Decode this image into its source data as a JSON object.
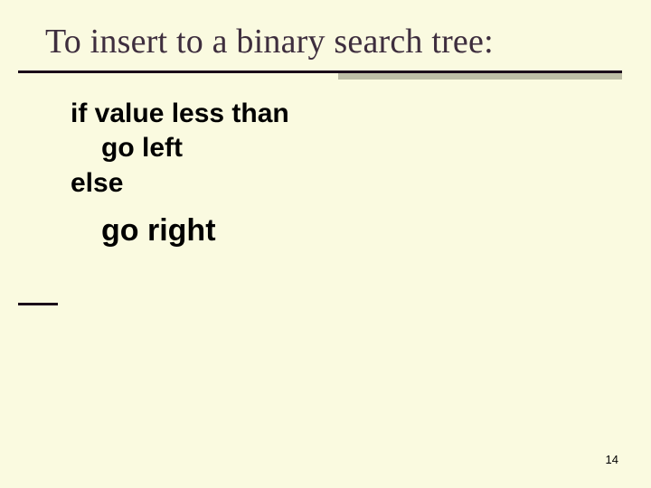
{
  "slide": {
    "title": "To insert to a binary search tree:",
    "lines": {
      "l1": "if value less than",
      "l2": "go left",
      "l3": "else",
      "l4": "go right"
    },
    "page_number": "14"
  }
}
